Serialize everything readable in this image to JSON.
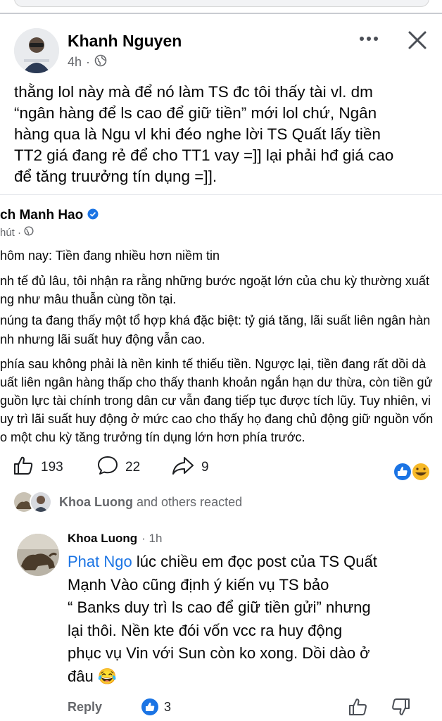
{
  "post": {
    "author": "Khanh Nguyen",
    "time": "4h",
    "dot": "·",
    "text_lines": [
      "thằng lol này mà để nó làm TS đc tôi thấy tài vl. dm",
      "“ngân hàng để ls cao để giữ tiền” mới lol chứ, Ngân",
      "hàng qua là Ngu vl khi đéo nghe lời TS Quất lấy tiền",
      "TT2 giá đang rẻ để cho TT1 vay =]] lại phải hđ giá cao",
      "để tăng truưởng tín dụng =]]."
    ]
  },
  "shared_post": {
    "author": "ch Manh Hao",
    "time": "hút ·",
    "lines": [
      "hôm nay: Tiền đang nhiều hơn niềm tin",
      "nh tế đủ lâu, tôi nhận ra rằng những bước ngoặt lớn của chu kỳ thường xuất",
      "ng như mâu thuẫn cùng tồn tại.",
      "núng ta đang thấy một tổ hợp khá đặc biệt: tỷ giá tăng, lãi suất liên ngân hàn",
      "nh nhưng lãi suất huy động vẫn cao.",
      "phía sau không phải là nền kinh tế thiếu tiền. Ngược lại, tiền đang rất dồi dà",
      "uất liên ngân hàng thấp cho thấy thanh khoản ngắn hạn dư thừa, còn tiền gử",
      "guồn lực tài chính trong dân cư vẫn đang tiếp tục được tích lũy. Tuy nhiên, vi",
      "uy trì lãi suất huy động ở mức cao cho thấy họ đang chủ động giữ nguồn vốn",
      "o một chu kỳ tăng trưởng tín dụng lớn hơn phía trước."
    ]
  },
  "stats": {
    "likes": "193",
    "comments": "22",
    "shares": "9"
  },
  "reacted": {
    "name": "Khoa Luong",
    "suffix": "and others reacted"
  },
  "comment": {
    "author": "Khoa Luong",
    "time": "· 1h",
    "mention": "Phat Ngo",
    "first_line_rest": " lúc chiều em đọc post của TS Quất",
    "lines": [
      "Mạnh Vào cũng định ý kiến vụ TS bảo",
      "“ Banks duy trì ls cao để giữ tiền gửi” nhưng",
      "lại thôi.  Nền kte đói vốn vcc ra huy động",
      "phục vụ Vin với Sun còn ko xong. Dồi dào ở"
    ],
    "last_line": "đâu",
    "emoji": "😂",
    "reply_label": "Reply",
    "like_count": "3"
  },
  "icons": {
    "more": "more-horizontal-icon",
    "close": "close-icon",
    "globe": "globe-icon",
    "verified": "verified-badge-icon",
    "like": "thumbs-up-icon",
    "comment": "comment-bubble-icon",
    "share": "share-arrow-icon",
    "dislike": "thumbs-down-icon"
  },
  "colors": {
    "accent": "#1b74e4",
    "muted": "#65676b",
    "text": "#050505"
  }
}
